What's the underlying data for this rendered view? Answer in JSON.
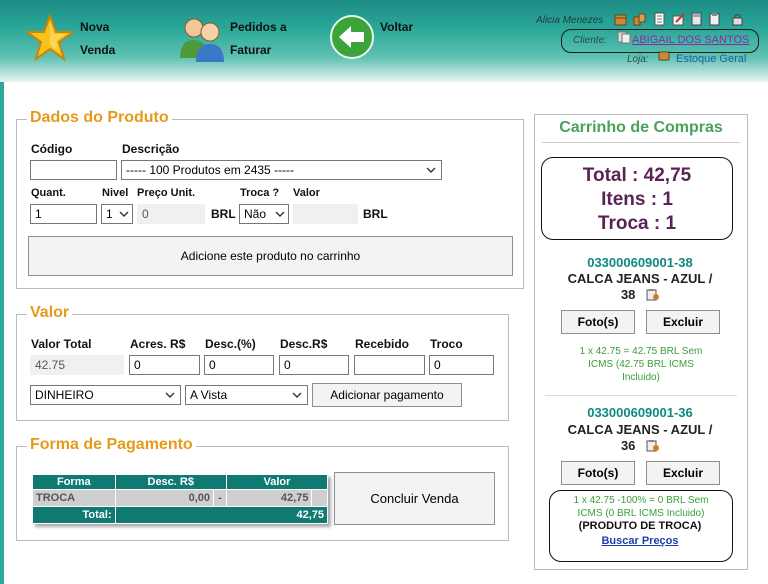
{
  "header": {
    "nav": [
      {
        "label": "Nova\nVenda",
        "icon": "star-icon"
      },
      {
        "label": "Pedidos a\nFaturar",
        "icon": "users-icon"
      },
      {
        "label": "Voltar",
        "icon": "back-arrow-icon"
      }
    ],
    "user": "Alicia Menezes",
    "client_label": "Cliente:",
    "client_name": "ABIGAIL DOS SANTOS",
    "store_label": "Loja:",
    "store_name": "Estoque Geral"
  },
  "produto": {
    "legend": "Dados do Produto",
    "codigo_label": "Código",
    "codigo_value": "",
    "descricao_label": "Descrição",
    "descricao_value": "----- 100 Produtos em 2435 -----",
    "quant_label": "Quant.",
    "quant_value": "1",
    "nivel_label": "Nivel",
    "nivel_value": "1",
    "preco_label": "Preço Unit.",
    "preco_value": "0",
    "brl": "BRL",
    "troca_label": "Troca ?",
    "troca_value": "Não",
    "valor_label": "Valor",
    "valor_value": "",
    "add_button": "Adicione este produto no carrinho"
  },
  "valor": {
    "legend": "Valor",
    "total_label": "Valor Total",
    "total_value": "42.75",
    "acres_label": "Acres. R$",
    "acres_value": "0",
    "descp_label": "Desc.(%)",
    "descp_value": "0",
    "descr_label": "Desc.R$",
    "descr_value": "0",
    "recebido_label": "Recebido",
    "recebido_value": "",
    "troco_label": "Troco",
    "troco_value": "0",
    "forma_select": "DINHEIRO",
    "prazo_select": "A Vista",
    "add_pay_button": "Adicionar pagamento"
  },
  "pagamento": {
    "legend": "Forma de Pagamento",
    "headers": [
      "Forma",
      "Desc. R$",
      "Valor"
    ],
    "row": {
      "forma": "TROCA",
      "desc": "0,00",
      "sep": "-",
      "valor": "42,75"
    },
    "total_label": "Total:",
    "total_value": "42,75",
    "concluir_button": "Concluir Venda"
  },
  "cart": {
    "title": "Carrinho de Compras",
    "total_line": "Total :  42,75",
    "itens_line": "Itens :  1",
    "troca_line": "Troca :  1",
    "items": [
      {
        "code": "033000609001-38",
        "name_l1": "CALCA JEANS - AZUL /",
        "name_l2": "38",
        "foto": "Foto(s)",
        "excluir": "Excluir",
        "price_l1": "1 x 42.75 = 42.75 BRL Sem",
        "price_l2": "ICMS (42.75 BRL ICMS",
        "price_l3": "Incluido)"
      },
      {
        "code": "033000609001-36",
        "name_l1": "CALCA JEANS - AZUL /",
        "name_l2": "36",
        "foto": "Foto(s)",
        "excluir": "Excluir",
        "price_l1": "1 x 42.75 -100% = 0 BRL Sem",
        "price_l2": "ICMS (0 BRL ICMS Incluido)",
        "tag": "(PRODUTO DE TROCA)",
        "buscar": "Buscar Preços"
      }
    ]
  },
  "colors": {
    "header_teal": "#2aa89a",
    "legend_orange": "#e69a1c",
    "cart_green": "#4aa25a",
    "summary_purple": "#5a2357",
    "code_teal": "#0f8a80",
    "table_teal": "#0f7a72"
  }
}
